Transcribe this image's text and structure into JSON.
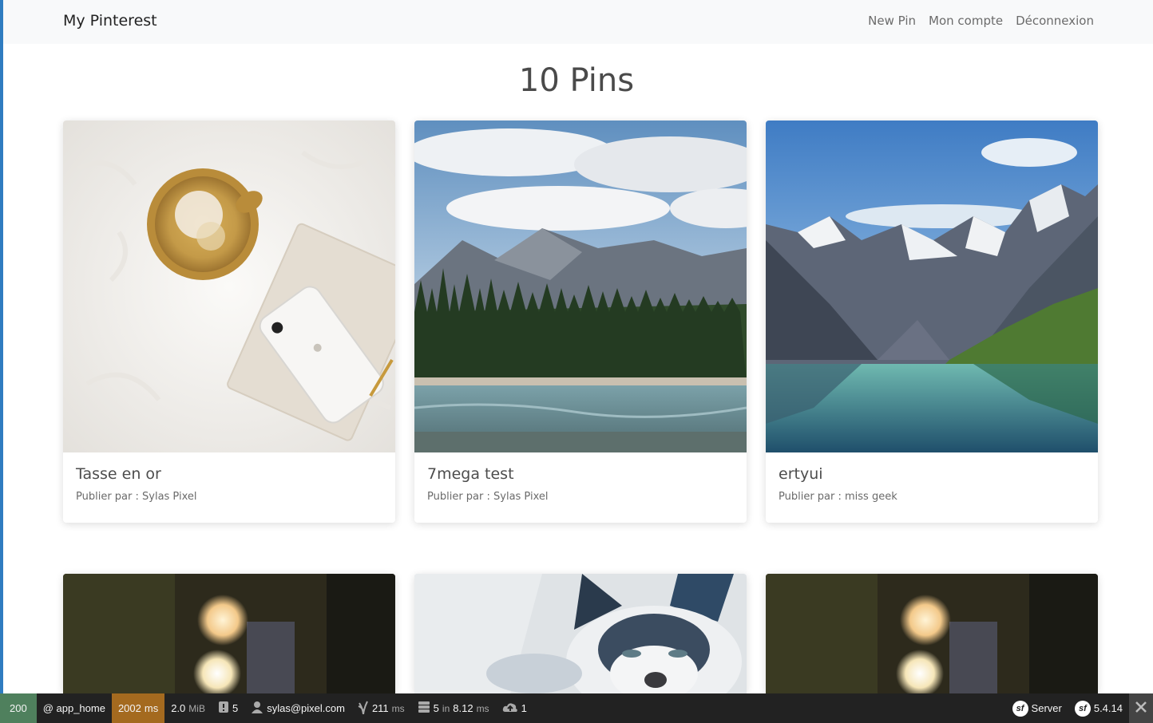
{
  "navbar": {
    "brand": "My Pinterest",
    "links": [
      "New Pin",
      "Mon compte",
      "Déconnexion"
    ]
  },
  "page_title": "10 Pins",
  "pins": [
    {
      "title": "Tasse en or",
      "author": "Publier par : Sylas Pixel",
      "image": "gold-cup-on-fur-photo"
    },
    {
      "title": "7mega test",
      "author": "Publier par : Sylas Pixel",
      "image": "mountain-lake-forest-photo"
    },
    {
      "title": "ertyui",
      "author": "Publier par : miss geek",
      "image": "glacier-valley-lake-photo"
    },
    {
      "image": "bokeh-lights-photo"
    },
    {
      "image": "cat-photo"
    },
    {
      "image": "bokeh-lights-photo"
    }
  ],
  "debug_toolbar": {
    "status": "200",
    "route": "@ app_home",
    "time_value": "2002",
    "time_unit": "ms",
    "memory_value": "2.0",
    "memory_unit": "MiB",
    "logs": "5",
    "user": "sylas@pixel.com",
    "ajax_value": "211",
    "ajax_unit": "ms",
    "db_queries": "5",
    "db_in": "in",
    "db_time": "8.12",
    "db_unit": "ms",
    "cache": "1",
    "server": "Server",
    "version": "5.4.14",
    "colors": {
      "status": "#4f805d",
      "time": "#a46a1f",
      "background": "#222222"
    }
  }
}
